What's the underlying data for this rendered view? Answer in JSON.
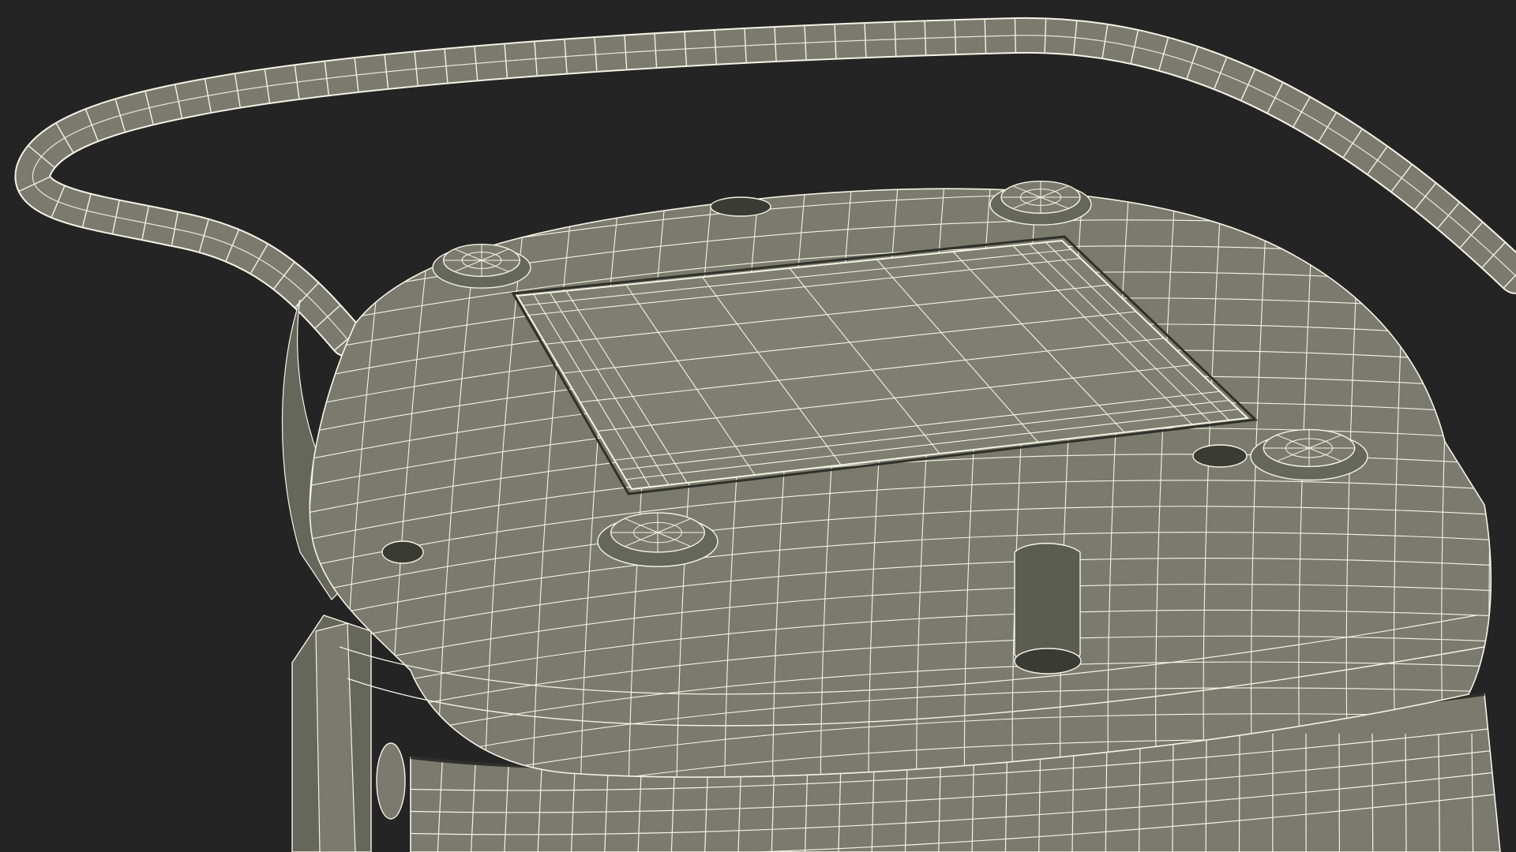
{
  "scene": {
    "background_color": "#242424",
    "mesh_fill_color": "#7a7b6e",
    "mesh_fill_shade": "#66675b",
    "mesh_fill_light": "#898a7c",
    "wire_color": "#f4f3e6"
  }
}
